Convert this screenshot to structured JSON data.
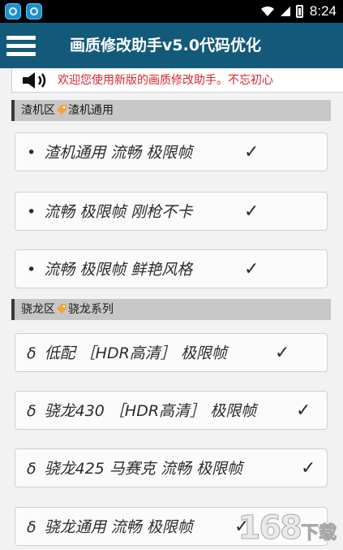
{
  "status_bar": {
    "time": "8:24"
  },
  "header": {
    "title": "画质修改助手v5.0代码优化"
  },
  "notice": {
    "text": "欢迎您使用新版的画质修改助手。不忘初心"
  },
  "sections": [
    {
      "label_left": "渣机区",
      "label_right": "渣机通用",
      "items": [
        {
          "marker": "•",
          "label": "渣机通用  流畅  极限帧",
          "check": "✓"
        },
        {
          "marker": "•",
          "label": "流畅  极限帧  刚枪不卡",
          "check": "✓"
        },
        {
          "marker": "•",
          "label": "流畅  极限帧  鲜艳风格",
          "check": "✓"
        }
      ]
    },
    {
      "label_left": "骁龙区",
      "label_right": "骁龙系列",
      "items": [
        {
          "marker": "δ",
          "label": "低配  ［HDR高清］  极限帧",
          "check": "✓"
        },
        {
          "marker": "δ",
          "label": "骁龙430  ［HDR高清］  极限帧",
          "check": "✓"
        },
        {
          "marker": "δ",
          "label": "骁龙425  马赛克  流畅  极限帧",
          "check": "✓"
        },
        {
          "marker": "δ",
          "label": "骁龙通用  流畅  极限帧",
          "check": "✓"
        }
      ]
    }
  ],
  "watermark": {
    "number": "168",
    "text": "下载"
  },
  "colors": {
    "title_bar": "#135a7a",
    "notice_text": "#d9232a",
    "section_bg": "#c7c7c7"
  }
}
